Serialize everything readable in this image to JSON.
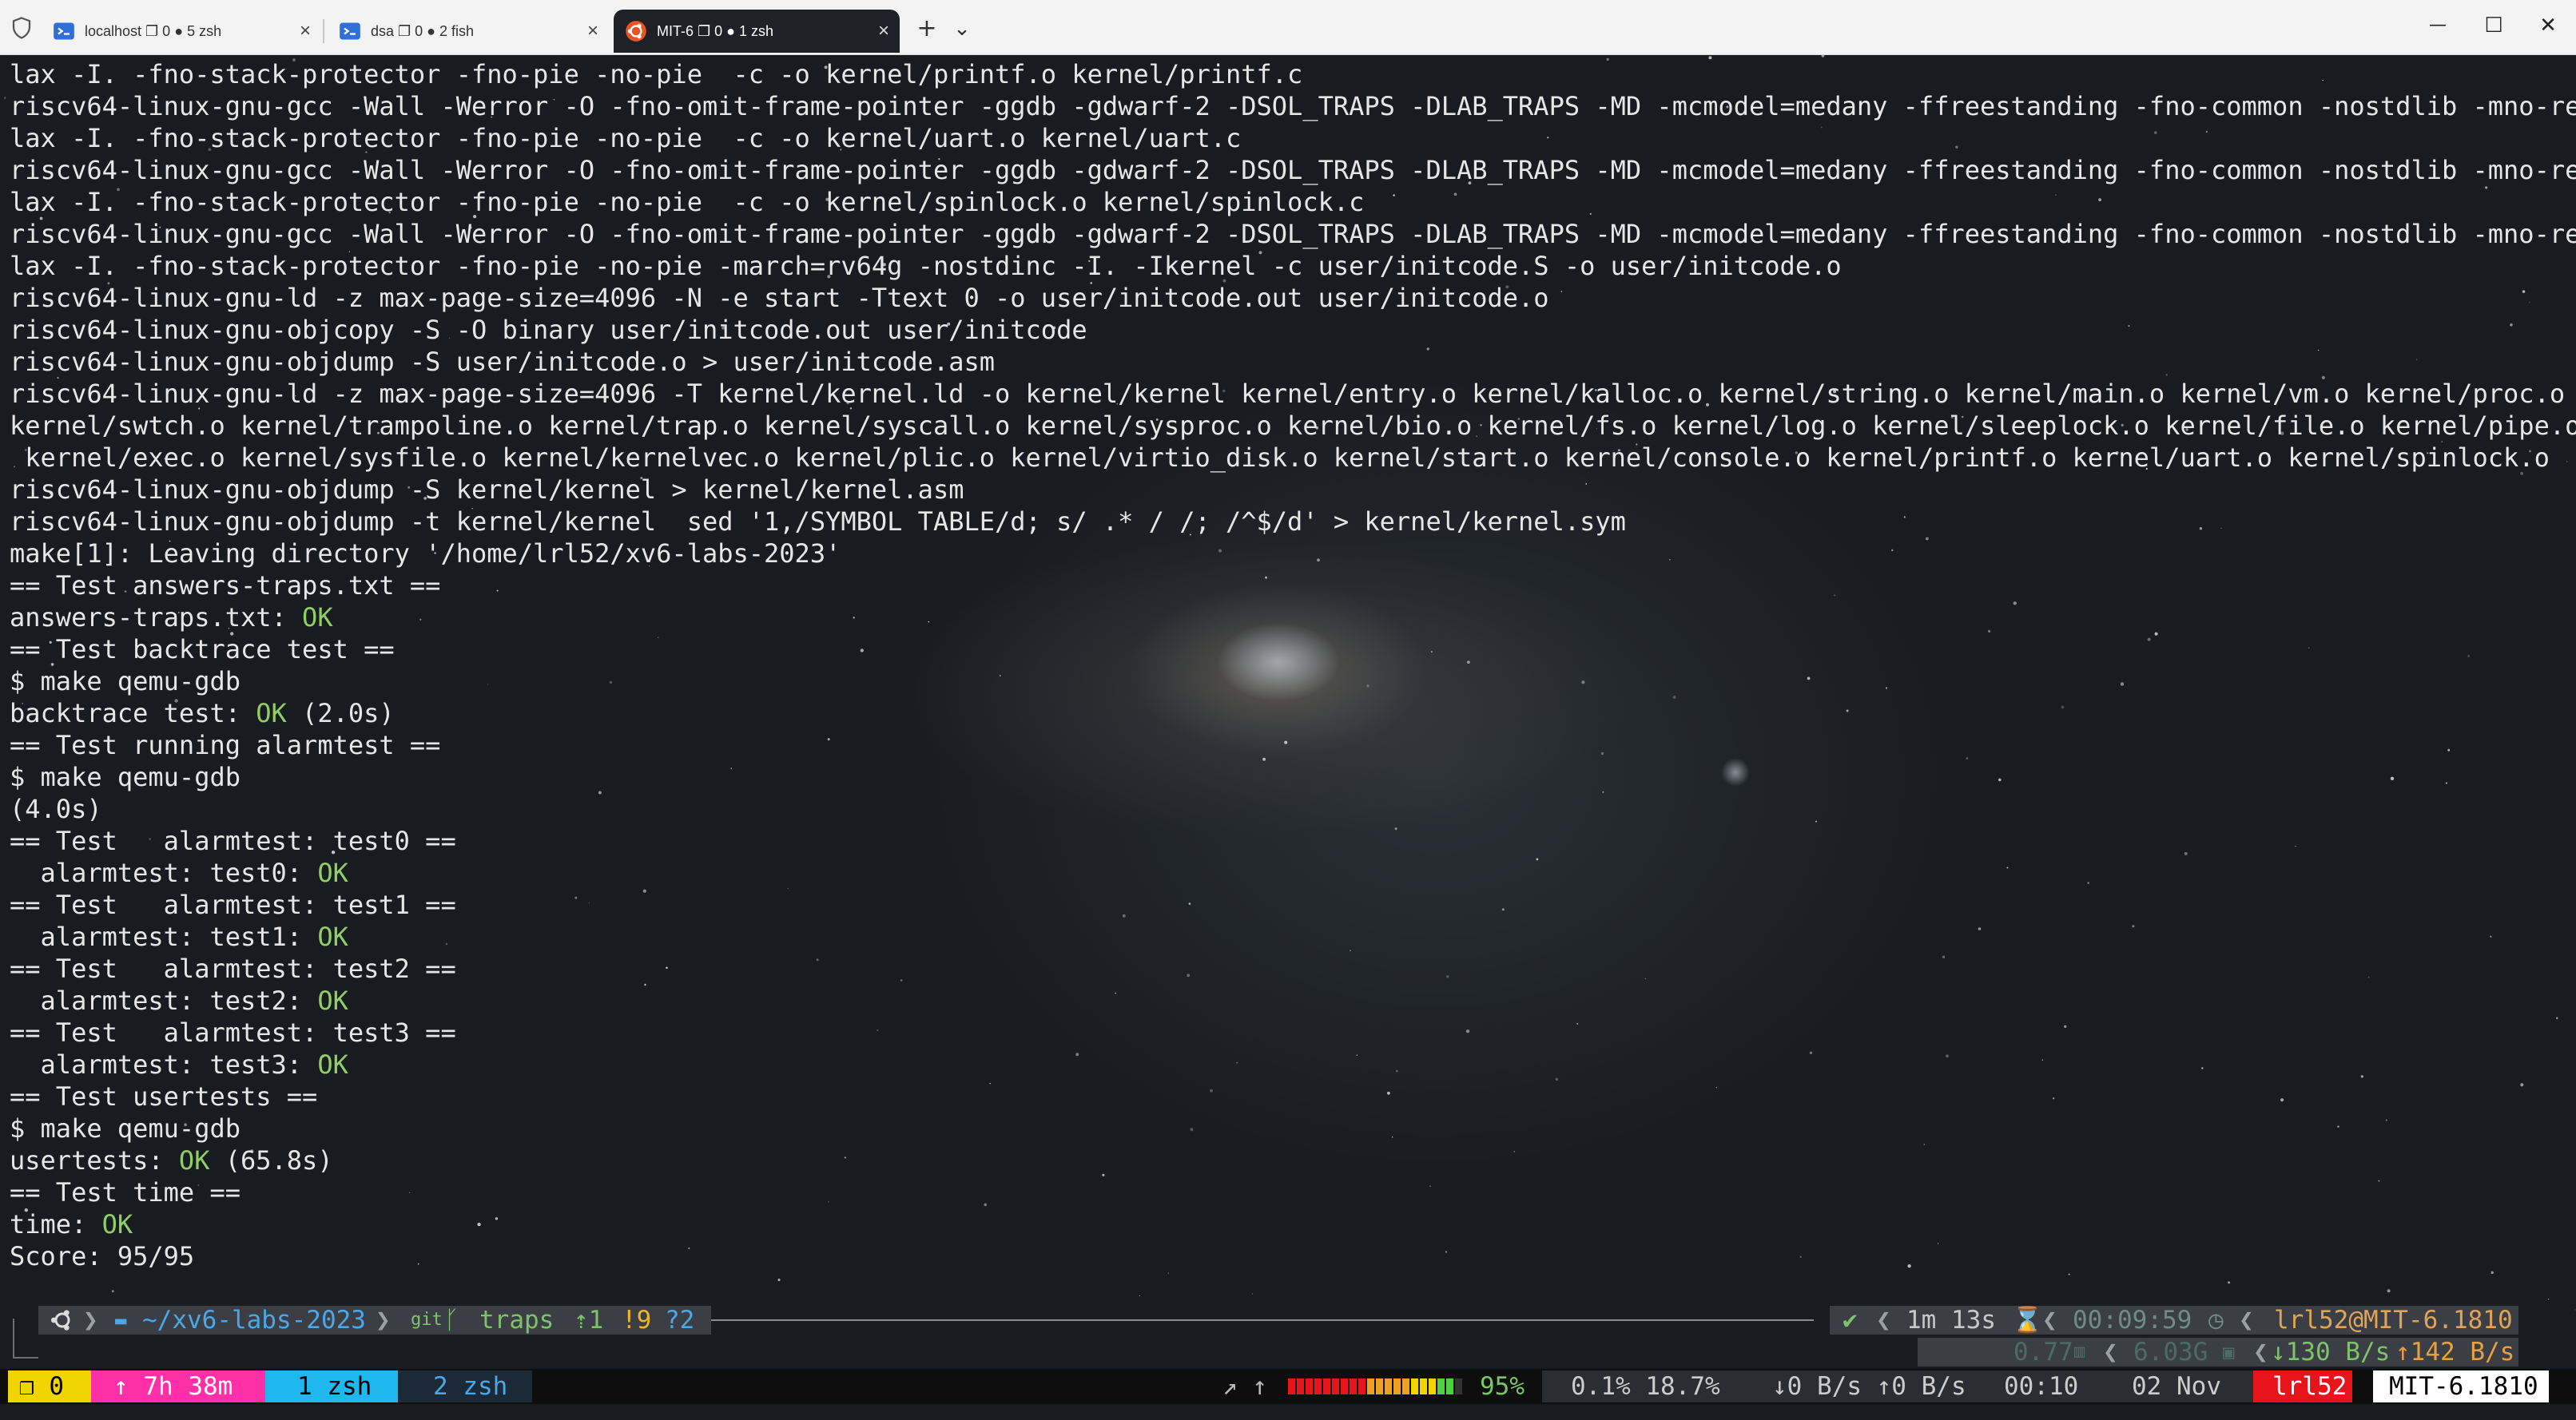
{
  "tabs": [
    {
      "label": "localhost ❐ 0 ● 5 zsh",
      "icon": "terminal-icon",
      "active": false
    },
    {
      "label": "dsa ❐ 0 ● 2 fish",
      "icon": "terminal-icon",
      "active": false
    },
    {
      "label": "MIT-6 ❐ 0 ● 1 zsh",
      "icon": "ubuntu-icon",
      "active": true
    }
  ],
  "toolbar": {
    "new_tab": "+",
    "dropdown": "⌄"
  },
  "window": {
    "minimize": "—",
    "maximize": "☐",
    "close": "✕"
  },
  "terminal": {
    "lines": [
      "lax -I. -fno-stack-protector -fno-pie -no-pie  -c -o kernel/printf.o kernel/printf.c",
      "riscv64-linux-gnu-gcc -Wall -Werror -O -fno-omit-frame-pointer -ggdb -gdwarf-2 -DSOL_TRAPS -DLAB_TRAPS -MD -mcmodel=medany -ffreestanding -fno-common -nostdlib -mno-re",
      "lax -I. -fno-stack-protector -fno-pie -no-pie  -c -o kernel/uart.o kernel/uart.c",
      "riscv64-linux-gnu-gcc -Wall -Werror -O -fno-omit-frame-pointer -ggdb -gdwarf-2 -DSOL_TRAPS -DLAB_TRAPS -MD -mcmodel=medany -ffreestanding -fno-common -nostdlib -mno-re",
      "lax -I. -fno-stack-protector -fno-pie -no-pie  -c -o kernel/spinlock.o kernel/spinlock.c",
      "riscv64-linux-gnu-gcc -Wall -Werror -O -fno-omit-frame-pointer -ggdb -gdwarf-2 -DSOL_TRAPS -DLAB_TRAPS -MD -mcmodel=medany -ffreestanding -fno-common -nostdlib -mno-re",
      "lax -I. -fno-stack-protector -fno-pie -no-pie -march=rv64g -nostdinc -I. -Ikernel -c user/initcode.S -o user/initcode.o",
      "riscv64-linux-gnu-ld -z max-page-size=4096 -N -e start -Ttext 0 -o user/initcode.out user/initcode.o",
      "riscv64-linux-gnu-objcopy -S -O binary user/initcode.out user/initcode",
      "riscv64-linux-gnu-objdump -S user/initcode.o > user/initcode.asm",
      "riscv64-linux-gnu-ld -z max-page-size=4096 -T kernel/kernel.ld -o kernel/kernel kernel/entry.o kernel/kalloc.o kernel/string.o kernel/main.o kernel/vm.o kernel/proc.o",
      "kernel/swtch.o kernel/trampoline.o kernel/trap.o kernel/syscall.o kernel/sysproc.o kernel/bio.o kernel/fs.o kernel/log.o kernel/sleeplock.o kernel/file.o kernel/pipe.o",
      " kernel/exec.o kernel/sysfile.o kernel/kernelvec.o kernel/plic.o kernel/virtio_disk.o kernel/start.o kernel/console.o kernel/printf.o kernel/uart.o kernel/spinlock.o",
      "riscv64-linux-gnu-objdump -S kernel/kernel > kernel/kernel.asm",
      "riscv64-linux-gnu-objdump -t kernel/kernel | sed '1,/SYMBOL TABLE/d; s/ .* / /; /^$/d' > kernel/kernel.sym",
      "make[1]: Leaving directory '/home/lrl52/xv6-labs-2023'",
      "== Test answers-traps.txt ==",
      "answers-traps.txt: |OK|",
      "== Test backtrace test ==",
      "$ make qemu-gdb",
      "backtrace test: |OK| (2.0s)",
      "== Test running alarmtest ==",
      "$ make qemu-gdb",
      "(4.0s)",
      "== Test   alarmtest: test0 ==",
      "  alarmtest: test0: |OK|",
      "== Test   alarmtest: test1 ==",
      "  alarmtest: test1: |OK|",
      "== Test   alarmtest: test2 ==",
      "  alarmtest: test2: |OK|",
      "== Test   alarmtest: test3 ==",
      "  alarmtest: test3: |OK|",
      "== Test usertests ==",
      "$ make qemu-gdb",
      "usertests: |OK| (65.8s)",
      "== Test time ==",
      "time: |OK|",
      "Score: 95/95"
    ]
  },
  "prompt": {
    "os_icon": "ubuntu-icon",
    "folder_icon": "folder-icon",
    "dir": "~/xv6-labs-2023",
    "git_label": "git",
    "branch_icon": "branch-icon",
    "branch": "traps",
    "ahead": "⇡1",
    "modified": "!9",
    "untracked": "?2",
    "status_ok": "✔",
    "duration": "1m 13s",
    "hourglass_icon": "hourglass-icon",
    "clock": "00:09:59",
    "clock_icon": "clock-icon",
    "user_host": "lrl52@MIT-6.1810",
    "load": "0.77",
    "load_icon": "chart-icon",
    "ram": "6.03G",
    "ram_icon": "memory-icon",
    "net_down": "↓130 B/s",
    "net_up": "↑142 B/s"
  },
  "statusbar": {
    "session": "❐ 0",
    "uptime": "↑ 7h 38m",
    "win1": "1 zsh",
    "win2": "2 zsh",
    "arrows": "↗ ↑",
    "battery_pct": "95%",
    "battery_level": 0.95,
    "cpu": "0.1% 18.7%",
    "net": "↓0 B/s ↑0 B/s",
    "time": "00:10",
    "date": "02 Nov",
    "user": "lrl52",
    "host": "MIT-6.1810"
  },
  "colors": {
    "ok": "#8fcf64",
    "text": "#e6e6e6",
    "dir": "#4aa8e8",
    "git": "#7ec36b",
    "yellow": "#f0d500",
    "magenta": "#ff2fa8",
    "cyan": "#1fb8ee",
    "red": "#e8141c"
  }
}
